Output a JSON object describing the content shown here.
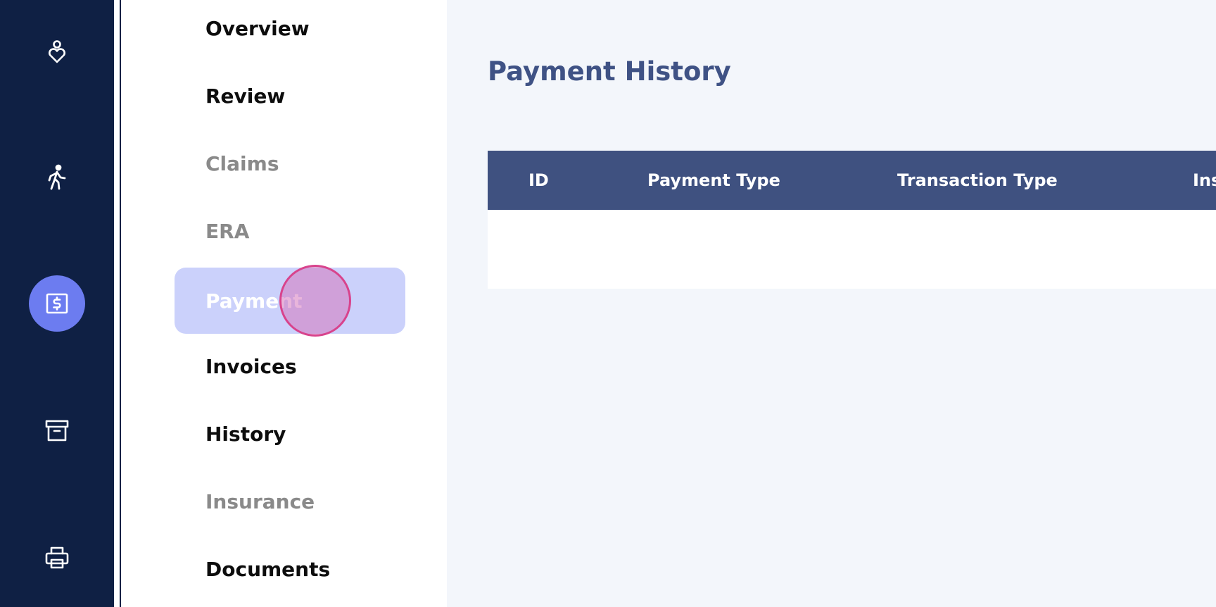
{
  "rail": {
    "items": [
      {
        "icon": "heart-person-icon"
      },
      {
        "icon": "walking-person-icon"
      },
      {
        "icon": "dollar-card-icon",
        "active": true
      },
      {
        "icon": "archive-box-icon"
      },
      {
        "icon": "printer-icon"
      }
    ],
    "active_color": "#6c7cf0",
    "background": "#0f2044"
  },
  "subnav": {
    "items": [
      {
        "label": "Overview",
        "state": "normal"
      },
      {
        "label": "Review",
        "state": "normal"
      },
      {
        "label": "Claims",
        "state": "disabled"
      },
      {
        "label": "ERA",
        "state": "disabled"
      },
      {
        "label": "Payment",
        "state": "active"
      },
      {
        "label": "Invoices",
        "state": "normal"
      },
      {
        "label": "History",
        "state": "normal"
      },
      {
        "label": "Insurance",
        "state": "disabled"
      },
      {
        "label": "Documents",
        "state": "normal"
      }
    ]
  },
  "main": {
    "title": "Payment History",
    "table": {
      "columns": [
        "ID",
        "Payment Type",
        "Transaction Type",
        "Ins"
      ],
      "rows": []
    }
  }
}
